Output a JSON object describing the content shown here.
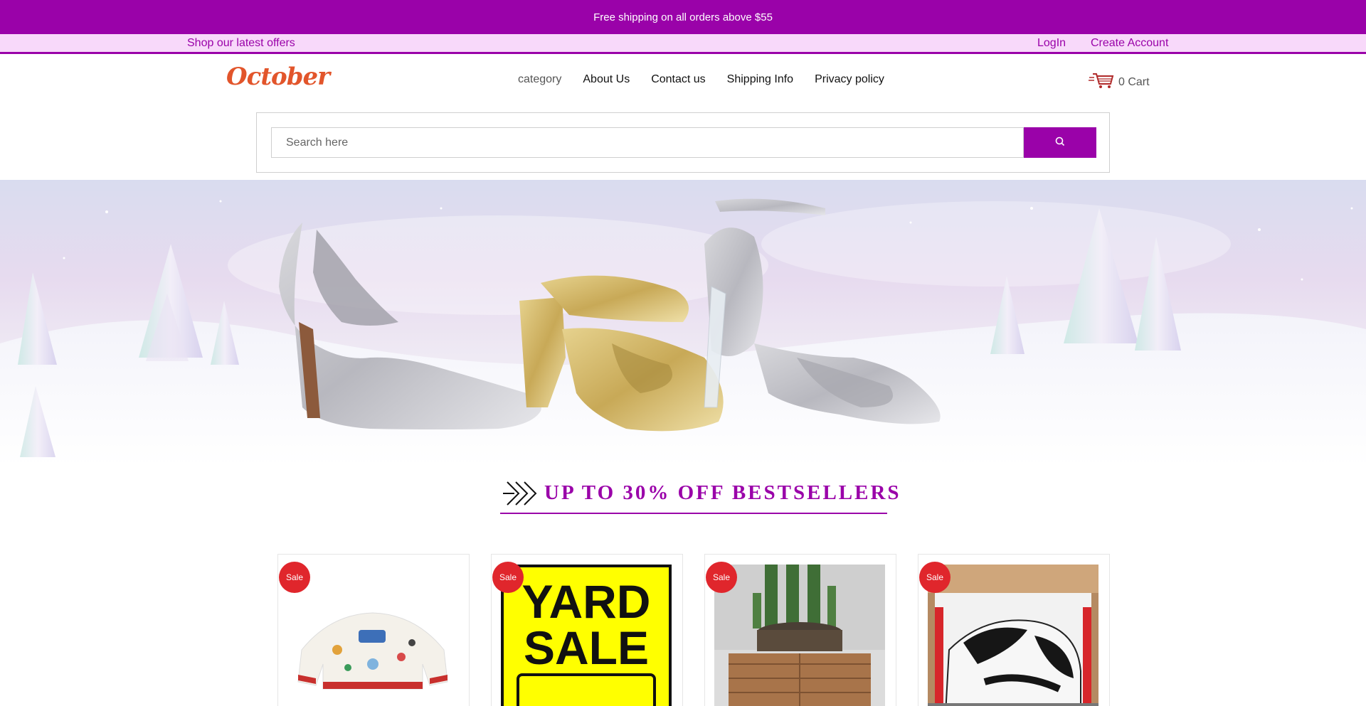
{
  "announcement": {
    "text": "Free shipping on all orders above $55"
  },
  "subbar": {
    "offers": "Shop our latest offers",
    "login": "LogIn",
    "create_account": "Create Account"
  },
  "header": {
    "logo_text": "October",
    "nav": [
      {
        "label": "category"
      },
      {
        "label": "About Us"
      },
      {
        "label": "Contact us"
      },
      {
        "label": "Shipping Info"
      },
      {
        "label": "Privacy policy"
      }
    ],
    "cart": {
      "label": "0 Cart",
      "icon": "cart-icon"
    }
  },
  "search": {
    "placeholder": "Search here",
    "icon": "search-icon"
  },
  "promo": {
    "title": "UP TO 30% OFF BESTSELLERS",
    "icon": "double-chevron-right-icon"
  },
  "products": [
    {
      "badge": "Sale",
      "image": "printed sweater"
    },
    {
      "badge": "Sale",
      "image": "yard sale sign",
      "image_text": [
        "YARD",
        "SALE"
      ]
    },
    {
      "badge": "Sale",
      "image": "cactus on wooden box"
    },
    {
      "badge": "Sale",
      "image": "sneakers in box"
    }
  ],
  "colors": {
    "brand": "#9a02a9",
    "subbar_bg": "#f8d9fa",
    "sale_badge": "#e0262c",
    "logo": "#e2552b"
  }
}
